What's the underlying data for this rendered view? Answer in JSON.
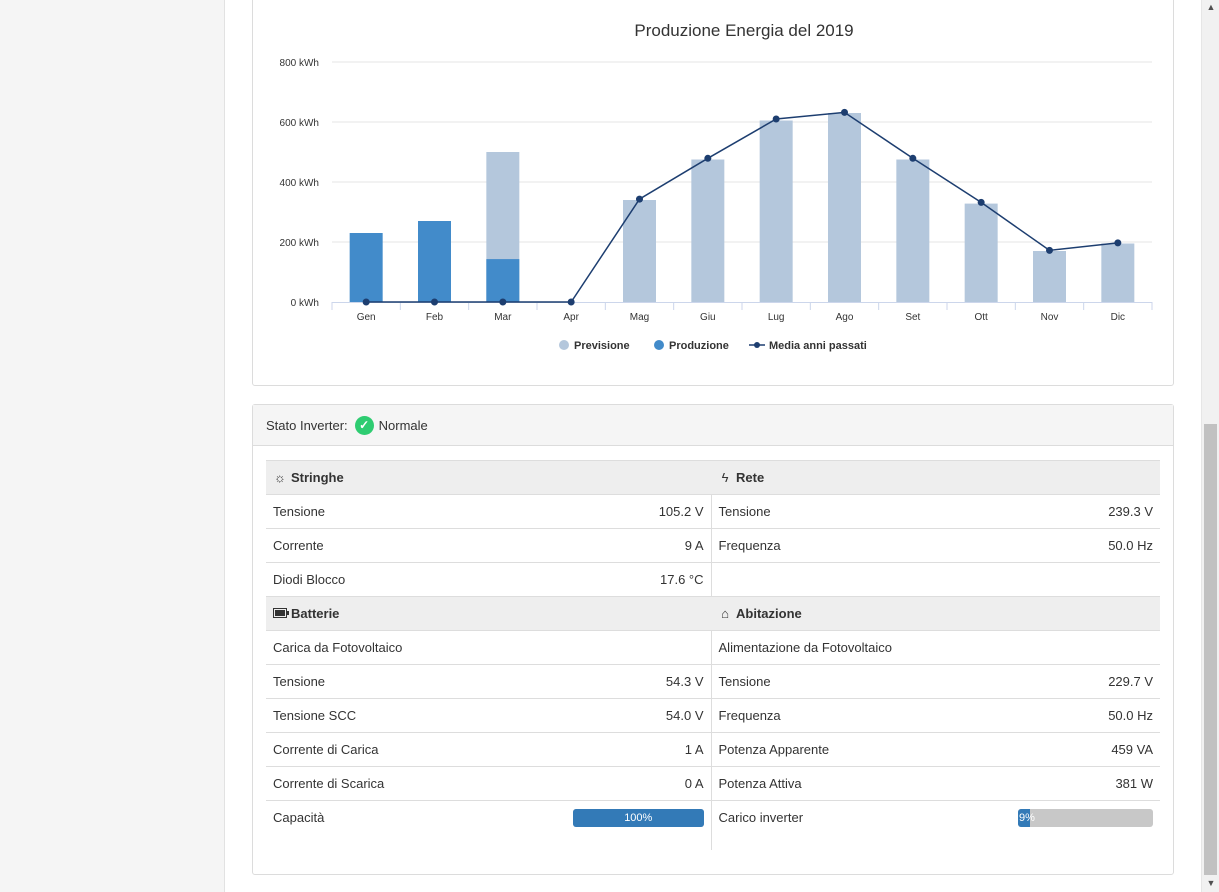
{
  "chart_data": {
    "type": "bar",
    "title": "Produzione Energia del 2019",
    "categories": [
      "Gen",
      "Feb",
      "Mar",
      "Apr",
      "Mag",
      "Giu",
      "Lug",
      "Ago",
      "Set",
      "Ott",
      "Nov",
      "Dic"
    ],
    "y_ticks": [
      "0 kWh",
      "200 kWh",
      "400 kWh",
      "600 kWh",
      "800 kWh"
    ],
    "ylim": [
      0,
      800
    ],
    "grid": true,
    "legend_position": "bottom-center",
    "series": [
      {
        "name": "Previsione",
        "type": "bar",
        "color": "#b4c7dc",
        "values": [
          0,
          0,
          500,
          0,
          340,
          475,
          605,
          630,
          475,
          328,
          170,
          195
        ]
      },
      {
        "name": "Produzione",
        "type": "bar",
        "color": "#428bca",
        "values": [
          230,
          270,
          143,
          0,
          0,
          0,
          0,
          0,
          0,
          0,
          0,
          0
        ]
      },
      {
        "name": "Media anni passati",
        "type": "line",
        "color": "#1d3e70",
        "values": [
          0,
          0,
          0,
          0,
          343,
          479,
          610,
          632,
          479,
          332,
          172,
          197
        ]
      }
    ]
  },
  "inverter": {
    "label": "Stato Inverter:",
    "status": "Normale",
    "status_color": "#2ecc71"
  },
  "stringhe": {
    "title": "Stringhe",
    "rows": [
      {
        "label": "Tensione",
        "value": "105.2 V"
      },
      {
        "label": "Corrente",
        "value": "9 A"
      },
      {
        "label": "Diodi Blocco",
        "value": "17.6 °C"
      }
    ]
  },
  "rete": {
    "title": "Rete",
    "rows": [
      {
        "label": "Tensione",
        "value": "239.3 V"
      },
      {
        "label": "Frequenza",
        "value": "50.0 Hz"
      }
    ]
  },
  "batterie": {
    "title": "Batterie",
    "mode": "Carica da Fotovoltaico",
    "rows": [
      {
        "label": "Tensione",
        "value": "54.3 V"
      },
      {
        "label": "Tensione SCC",
        "value": "54.0 V"
      },
      {
        "label": "Corrente di Carica",
        "value": "1 A"
      },
      {
        "label": "Corrente di Scarica",
        "value": "0 A"
      }
    ],
    "capacity_label": "Capacità",
    "capacity_text": "100%",
    "capacity_percent": 100,
    "capacity_color": "#337ab7"
  },
  "abitazione": {
    "title": "Abitazione",
    "mode": "Alimentazione da Fotovoltaico",
    "rows": [
      {
        "label": "Tensione",
        "value": "229.7 V"
      },
      {
        "label": "Frequenza",
        "value": "50.0 Hz"
      },
      {
        "label": "Potenza Apparente",
        "value": "459 VA"
      },
      {
        "label": "Potenza Attiva",
        "value": "381 W"
      }
    ],
    "load_label": "Carico inverter",
    "load_text": "9%",
    "load_percent": 9,
    "load_color": "#337ab7"
  }
}
